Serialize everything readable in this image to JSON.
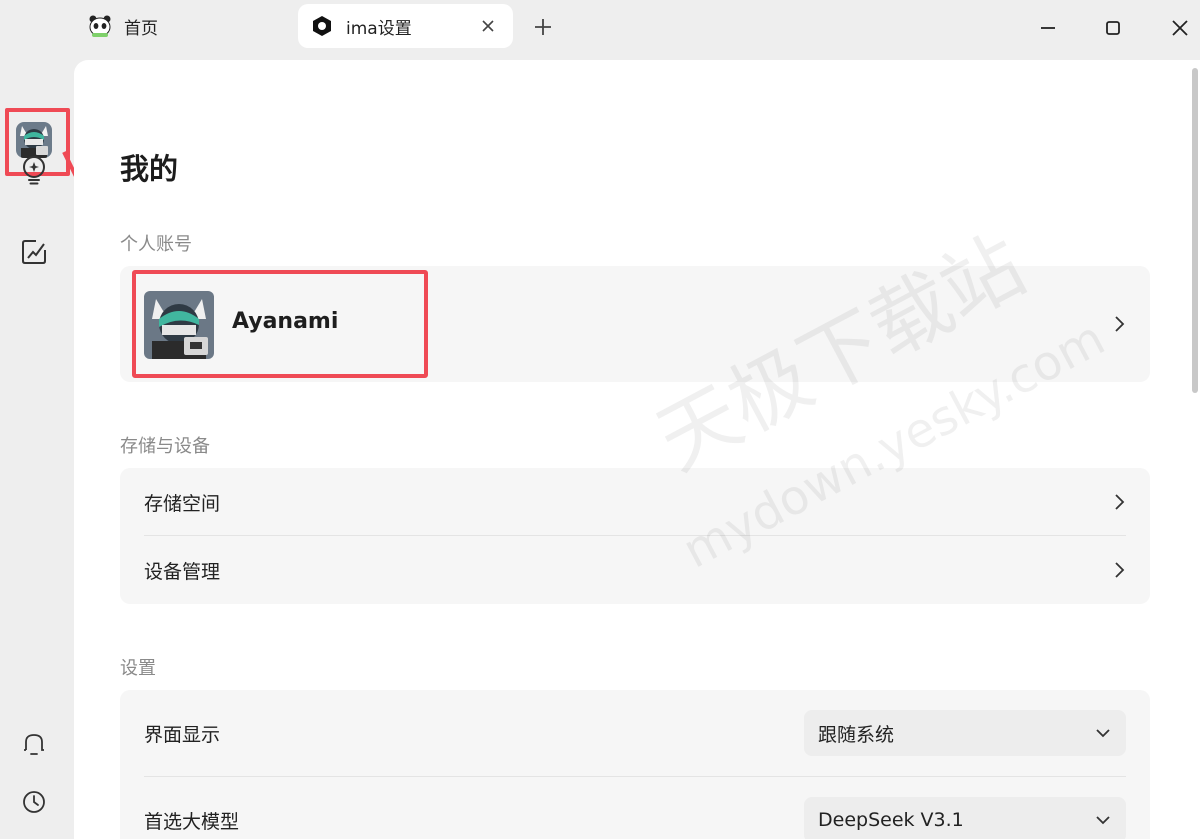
{
  "tabs": [
    {
      "label": "首页",
      "icon": "panda-icon"
    },
    {
      "label": "ima设置",
      "icon": "ima-logo-icon"
    }
  ],
  "sidebar": {
    "items": [
      "avatar",
      "lightbulb-icon",
      "chart-edit-icon",
      "bell-icon",
      "history-icon"
    ]
  },
  "page": {
    "title": "我的"
  },
  "account": {
    "section_label": "个人账号",
    "name": "Ayanami"
  },
  "storage": {
    "section_label": "存储与设备",
    "items": [
      {
        "label": "存储空间"
      },
      {
        "label": "设备管理"
      }
    ]
  },
  "settings": {
    "section_label": "设置",
    "items": [
      {
        "label": "界面显示",
        "value": "跟随系统"
      },
      {
        "label": "首选大模型",
        "value": "DeepSeek V3.1"
      }
    ]
  },
  "watermark": {
    "line1": "天极下载站",
    "line2": "mydown.yesky.com"
  },
  "colors": {
    "annotation": "#ef4a55",
    "panel_bg": "#ffffff",
    "card_bg": "#f6f6f6"
  }
}
